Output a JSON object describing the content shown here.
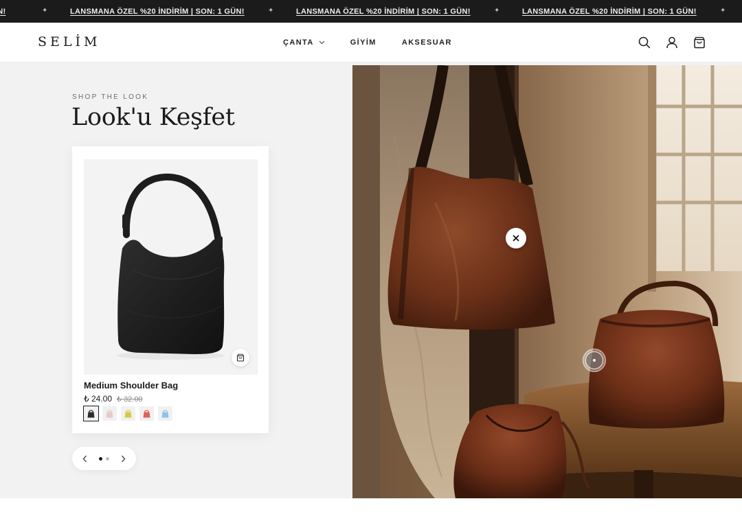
{
  "announcement": {
    "messages": [
      "LANSMANA ÖZEL %20 İNDİRİM | SON: 1 GÜN!",
      "LANSMANA ÖZEL %20 İNDİRİM | SON: 1 GÜN!",
      "LANSMANA ÖZEL %20 İNDİRİM | SON: 1 GÜN!"
    ],
    "partial_left": "ÜN!",
    "separator": "✦",
    "background": "#1b1b1b"
  },
  "header": {
    "logo": "SELİM",
    "nav": [
      {
        "label": "ÇANTA",
        "has_dropdown": true
      },
      {
        "label": "GİYİM",
        "has_dropdown": false
      },
      {
        "label": "AKSESUAR",
        "has_dropdown": false
      }
    ],
    "icons": [
      "search-icon",
      "account-icon",
      "cart-icon"
    ]
  },
  "shop_the_look": {
    "eyebrow": "SHOP THE LOOK",
    "title": "Look'u Keşfet",
    "product": {
      "name": "Medium Shoulder Bag",
      "price": "₺ 24.00",
      "compare_price": "₺ 32.00",
      "swatches": [
        {
          "color": "#2b2b2b",
          "active": true
        },
        {
          "color": "#e4c9c9",
          "active": false
        },
        {
          "color": "#d4c94a",
          "active": false
        },
        {
          "color": "#e0625a",
          "active": false
        },
        {
          "color": "#8cc3ea",
          "active": false
        }
      ]
    },
    "pager": {
      "pages": 2,
      "current": 1
    }
  },
  "colors": {
    "accent": "#1a1a1a",
    "section_bg": "#f2f2f2"
  }
}
